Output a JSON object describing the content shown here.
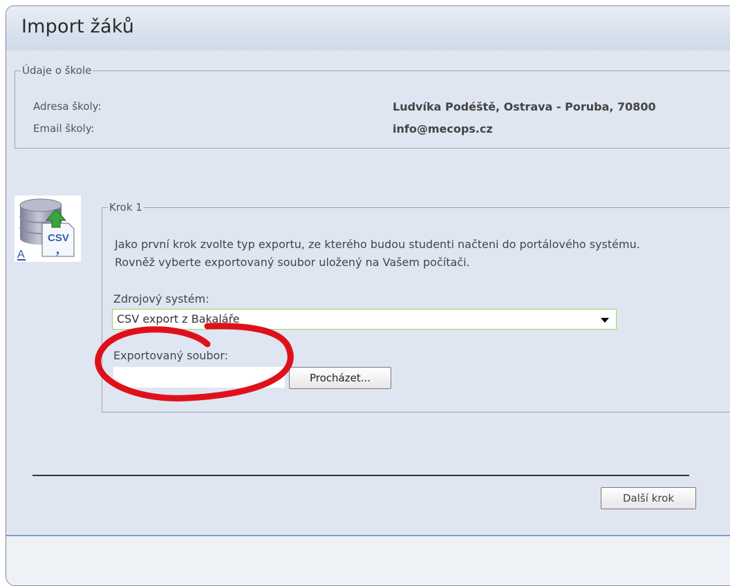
{
  "header": {
    "title": "Import žáků"
  },
  "school": {
    "legend": "Údaje o škole",
    "address_label": "Adresa školy:",
    "address_value": "Ludvíka Podéště, Ostrava - Poruba, 70800",
    "email_label": "Email školy:",
    "email_value": "info@mecops.cz"
  },
  "step": {
    "legend": "Krok 1",
    "description": "Jako první krok zvolte typ exportu, ze kterého budou studenti načteni do portálového systému. Rovněž vyberte exportovaný soubor uložený na Vašem počítači.",
    "source_label": "Zdrojový systém:",
    "source_selected": "CSV export z Bakaláře",
    "file_label": "Exportovaný soubor:",
    "file_value": "",
    "browse_label": "Procházet...",
    "icon": "database-csv-import-icon",
    "icon_text": "CSV",
    "icon_letter": "A"
  },
  "footer": {
    "next_label": "Další krok"
  },
  "colors": {
    "panel_bg": "#dfe6f2",
    "select_border": "#9bd46b",
    "highlight_circle": "#e0101a",
    "footer_line": "#7e9dcb"
  }
}
